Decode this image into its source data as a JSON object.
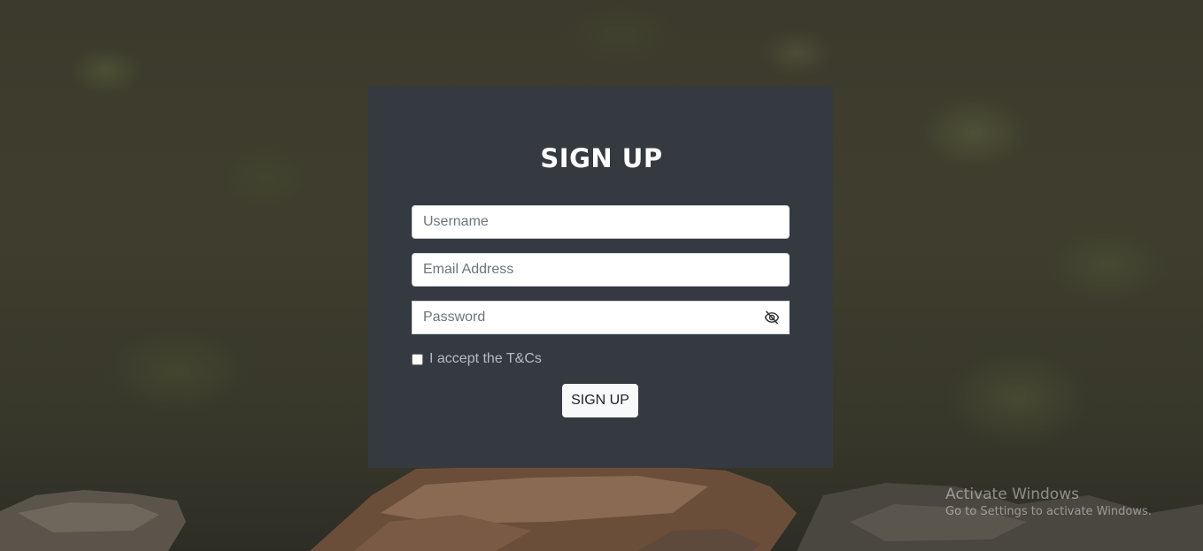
{
  "form": {
    "title": "SIGN UP",
    "username_placeholder": "Username",
    "email_placeholder": "Email Address",
    "password_placeholder": "Password",
    "password_toggle_icon": "eye-slash-icon",
    "terms_label": "I accept the T&Cs",
    "terms_checked": false,
    "submit_label": "SIGN UP"
  },
  "watermark": {
    "title": "Activate Windows",
    "subtitle": "Go to Settings to activate Windows."
  },
  "colors": {
    "card_background": "#343a40",
    "button_background": "#f8f9fa",
    "title_text": "#ffffff"
  }
}
